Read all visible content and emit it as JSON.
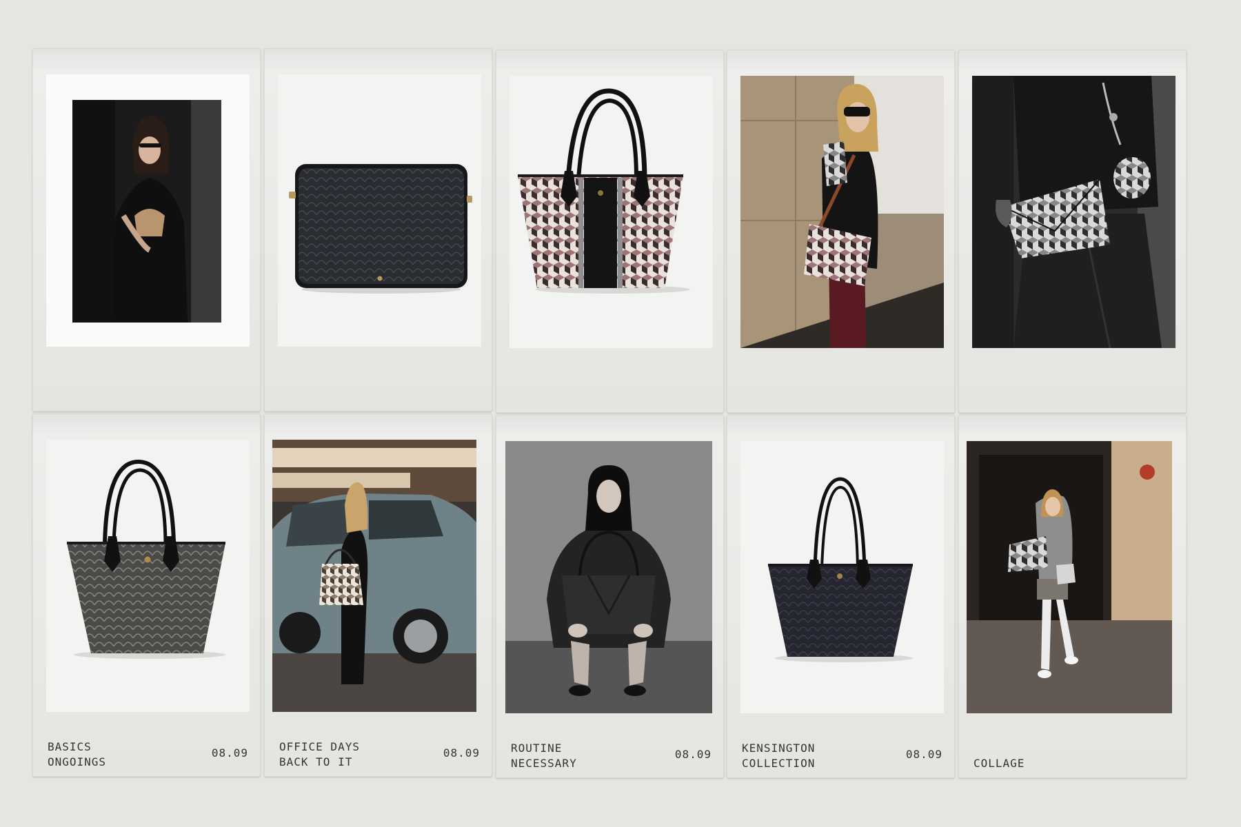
{
  "cards": [
    {
      "line1": "",
      "line2": "",
      "date": ""
    },
    {
      "line1": "",
      "line2": "",
      "date": ""
    },
    {
      "line1": "",
      "line2": "",
      "date": ""
    },
    {
      "line1": "",
      "line2": "",
      "date": ""
    },
    {
      "line1": "",
      "line2": "",
      "date": ""
    },
    {
      "line1": "BASICS",
      "line2": "ONGOINGS",
      "date": "08.09"
    },
    {
      "line1": "OFFICE DAYS",
      "line2": "BACK TO IT",
      "date": "08.09"
    },
    {
      "line1": "ROUTINE",
      "line2": "NECESSARY",
      "date": "08.09"
    },
    {
      "line1": "KENSINGTON",
      "line2": "COLLECTION",
      "date": "08.09"
    },
    {
      "line1": "COLLAGE",
      "line2": "",
      "date": ""
    }
  ],
  "icons": {
    "photo_0": "woman-with-tan-bag-photo",
    "photo_1": "black-laptop-case-photo",
    "photo_2": "striped-tote-bag-photo",
    "photo_3": "woman-with-crossbody-bag-photo",
    "photo_4": "monochrome-clutch-photo",
    "photo_5": "grey-tote-bag-photo",
    "photo_6": "woman-at-car-photo",
    "photo_7": "woman-crouching-with-tote-photo",
    "photo_8": "navy-tote-bag-photo",
    "photo_9": "woman-walking-street-photo"
  }
}
